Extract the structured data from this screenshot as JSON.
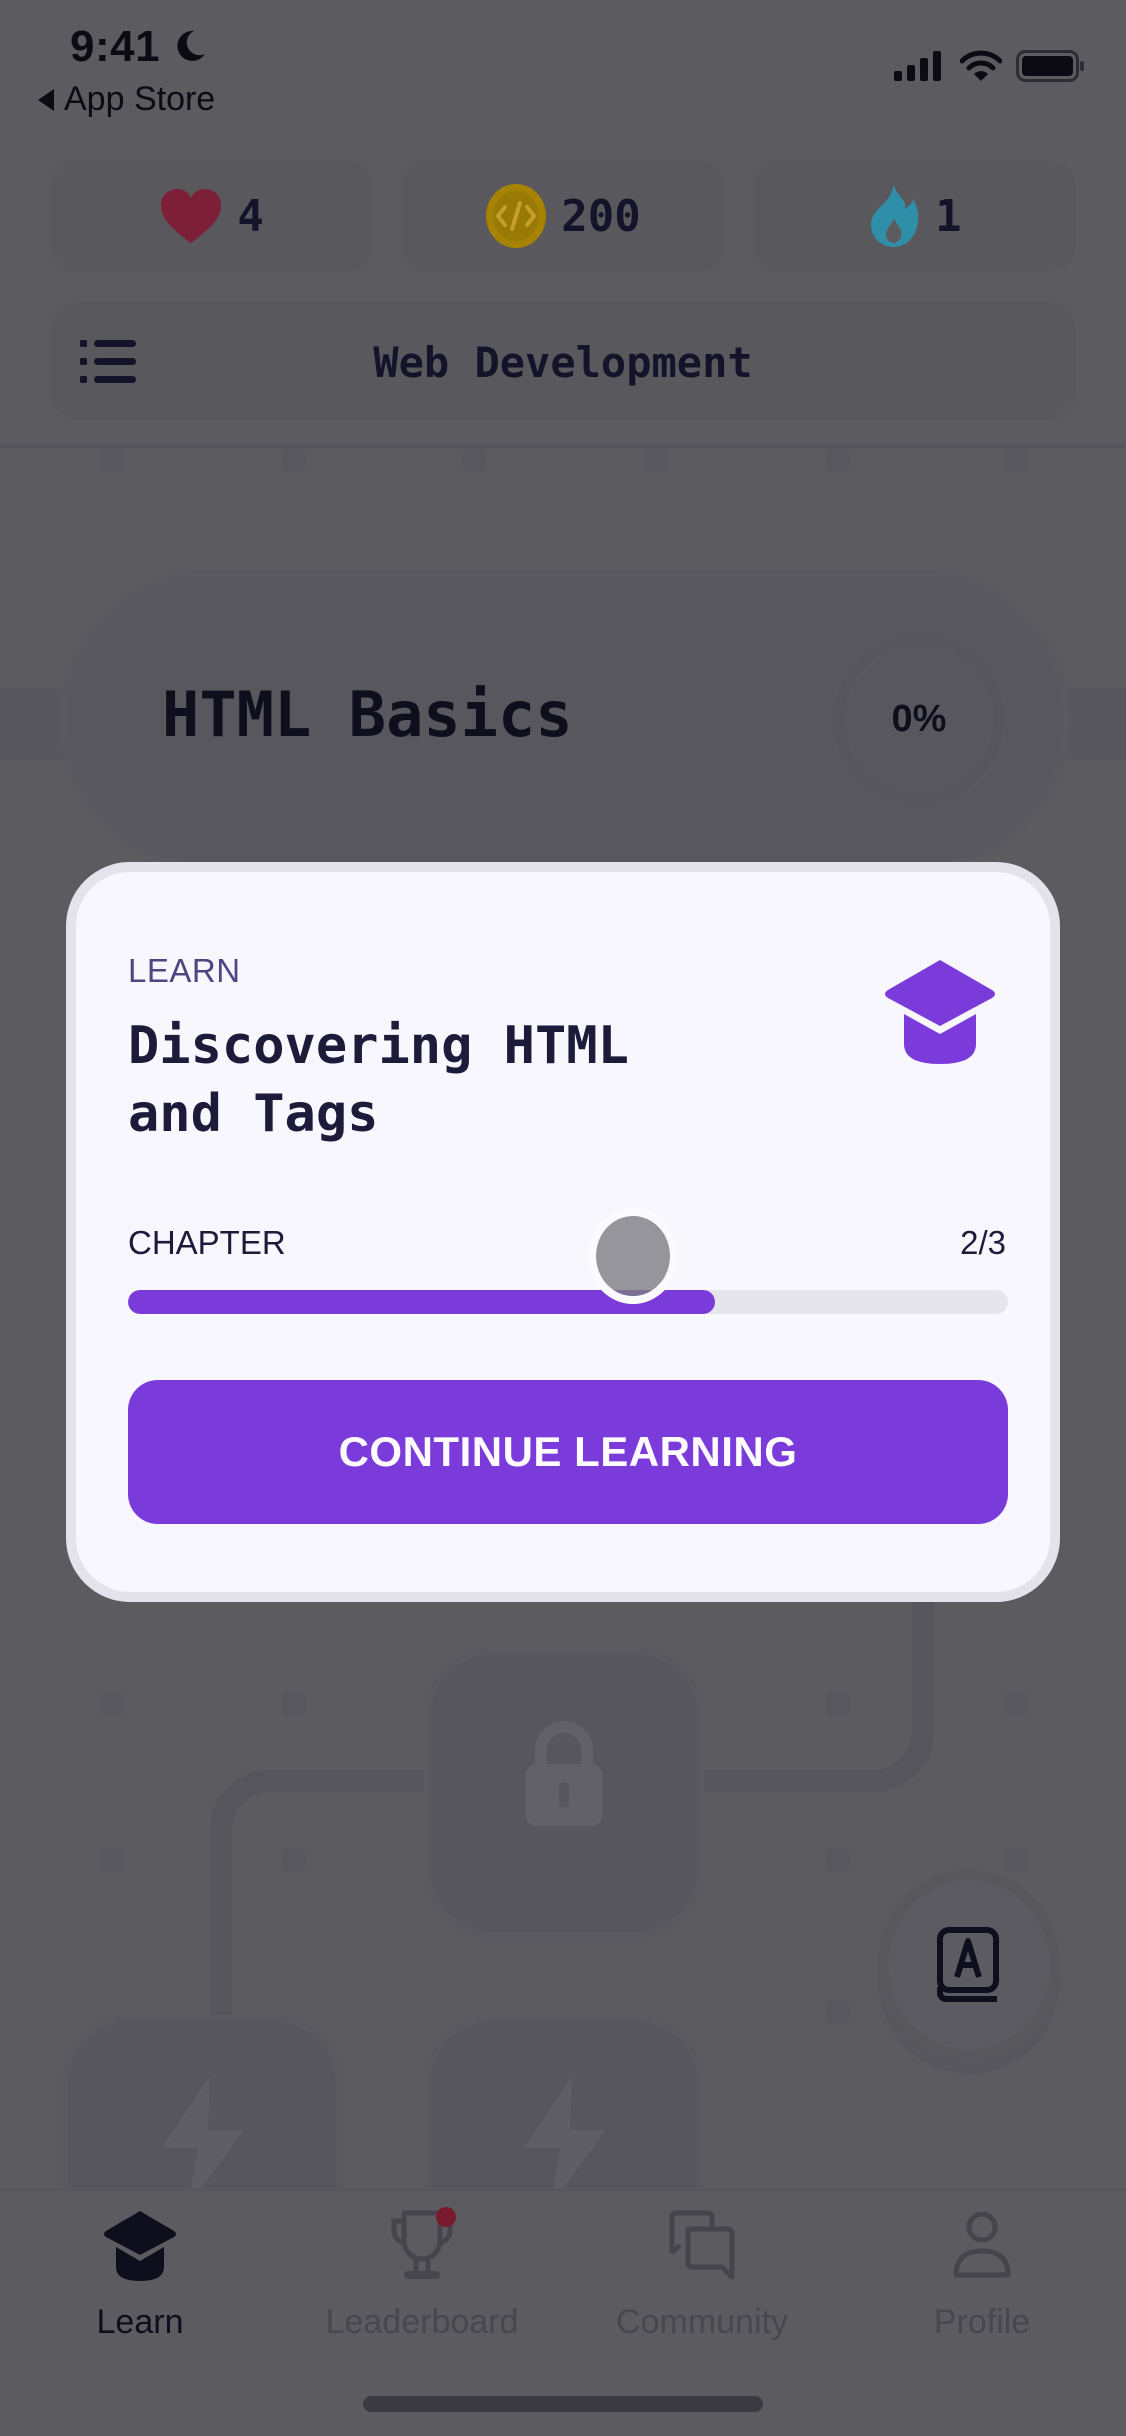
{
  "status_bar": {
    "time": "9:41",
    "back_label": "App Store",
    "icons": [
      "moon-icon",
      "cellular-signal-icon",
      "wifi-icon",
      "battery-icon"
    ]
  },
  "stats": {
    "lives": {
      "icon": "heart-icon",
      "value": "4",
      "color": "#7c1f37"
    },
    "coins": {
      "icon": "code-coin-icon",
      "value": "200",
      "color": "#b58e00"
    },
    "streak": {
      "icon": "flame-icon",
      "value": "1",
      "color": "#2f8fa8"
    }
  },
  "course": {
    "menu_icon": "list-icon",
    "title": "Web Development"
  },
  "unit": {
    "title": "HTML Basics",
    "progress_percent": "0%"
  },
  "modal": {
    "kicker": "LEARN",
    "title": "Discovering HTML and Tags",
    "icon": "graduation-cap-icon",
    "chapter_label": "CHAPTER",
    "chapter_count": "2/3",
    "chapter_progress": 0.667,
    "cta_label": "CONTINUE LEARNING",
    "accent_color": "#7b3bdb"
  },
  "path": {
    "locked_node_icon": "lock-icon",
    "practice_node_icon": "lightning-icon",
    "dictionary_button_icon": "dictionary-book-icon"
  },
  "tabbar": {
    "items": [
      {
        "label": "Learn",
        "icon": "graduation-cap-icon",
        "active": true
      },
      {
        "label": "Leaderboard",
        "icon": "trophy-icon",
        "badge": true
      },
      {
        "label": "Community",
        "icon": "chat-bubbles-icon"
      },
      {
        "label": "Profile",
        "icon": "person-icon"
      }
    ]
  }
}
